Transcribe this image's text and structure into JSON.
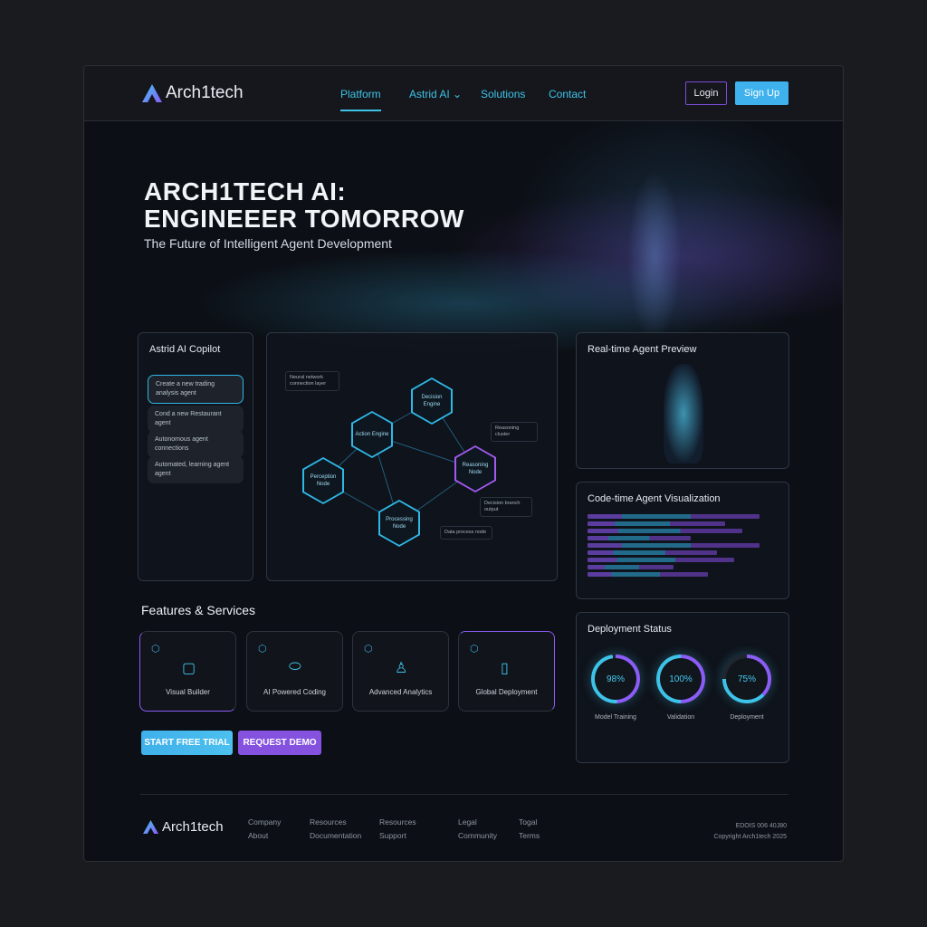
{
  "header": {
    "brand": "Arch1tech",
    "nav": [
      "Platform",
      "Astrid AI",
      "Solutions",
      "Contact"
    ],
    "login": "Login",
    "signup": "Sign Up"
  },
  "hero": {
    "title_line1": "ARCH1TECH AI:",
    "title_line2": "ENGINEEER TOMORROW",
    "subtitle": "The Future of Intelligent Agent Development"
  },
  "copilot": {
    "title": "Astrid AI Copilot",
    "messages": [
      "Create a new trading analysis agent",
      "Cond a new Restaurant agent",
      "Autonomous agent connections",
      "Automated, learning agent agent"
    ]
  },
  "graph": {
    "nodes": [
      "Decision Engine",
      "Action Engine",
      "Perception Node",
      "Reasoning Node",
      "Processing Node"
    ],
    "notes": [
      "Neural network connection layer",
      "Reasoning cluster",
      "Decision branch output",
      "Data process node"
    ]
  },
  "preview": {
    "title": "Real-time Agent Preview"
  },
  "code": {
    "title": "Code-time Agent Visualization"
  },
  "deployment": {
    "title": "Deployment Status",
    "items": [
      {
        "label": "Model Training",
        "value": "98%",
        "pct": 98
      },
      {
        "label": "Validation",
        "value": "100%",
        "pct": 100
      },
      {
        "label": "Deployment",
        "value": "75%",
        "pct": 75
      }
    ]
  },
  "features": {
    "title": "Features & Services",
    "items": [
      "Visual Builder",
      "AI Powered Coding",
      "Advanced Analytics",
      "Global Deployment"
    ]
  },
  "cta": {
    "trial": "START FREE TRIAL",
    "demo": "REQUEST DEMO"
  },
  "footer": {
    "brand": "Arch1tech",
    "cols": [
      [
        "Company",
        "About"
      ],
      [
        "Resources",
        "Documentation"
      ],
      [
        "Resources",
        "Support"
      ],
      [
        "Legal",
        "Community"
      ],
      [
        "Togal",
        "Terms"
      ]
    ],
    "contact": "EDOIS 006 40J80",
    "copyright": "Copyright Arch1tech 2025"
  },
  "colors": {
    "cyan": "#3ec3e8",
    "purple": "#8b5cf6"
  }
}
